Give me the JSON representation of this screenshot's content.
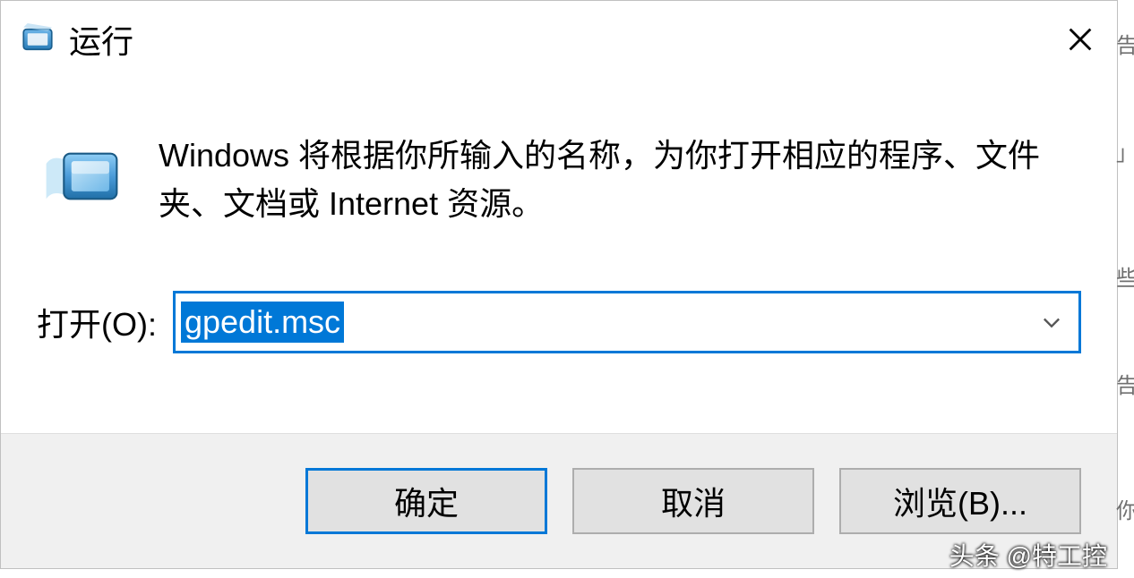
{
  "dialog": {
    "title": "运行",
    "description": "Windows 将根据你所输入的名称，为你打开相应的程序、文件夹、文档或 Internet 资源。",
    "open_label": "打开(O):",
    "input_value": "gpedit.msc",
    "buttons": {
      "ok": "确定",
      "cancel": "取消",
      "browse": "浏览(B)..."
    }
  },
  "watermark": "头条 @特工控"
}
